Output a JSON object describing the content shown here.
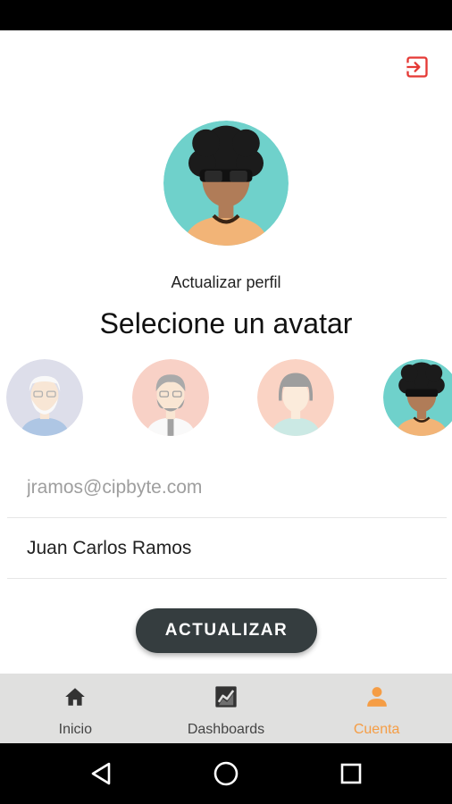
{
  "header": {
    "logout_icon": "logout-icon",
    "accent": "#e53935"
  },
  "profile": {
    "subtitle": "Actualizar perfil",
    "heading": "Selecione un avatar"
  },
  "avatars": [
    {
      "name": "old-man",
      "selected": false
    },
    {
      "name": "bearded-man",
      "selected": false
    },
    {
      "name": "woman",
      "selected": false
    },
    {
      "name": "afro-sunglasses",
      "selected": true
    }
  ],
  "form": {
    "email_placeholder": "jramos@cipbyte.com",
    "name_value": "Juan Carlos Ramos",
    "submit_label": "ACTUALIZAR"
  },
  "nav": {
    "items": [
      {
        "label": "Inicio",
        "icon": "home-icon"
      },
      {
        "label": "Dashboards",
        "icon": "chart-icon"
      },
      {
        "label": "Cuenta",
        "icon": "person-icon"
      }
    ],
    "active_color": "#f59d45"
  },
  "system_nav": {
    "icons": [
      "back-icon",
      "home-circle-icon",
      "recents-icon"
    ]
  }
}
